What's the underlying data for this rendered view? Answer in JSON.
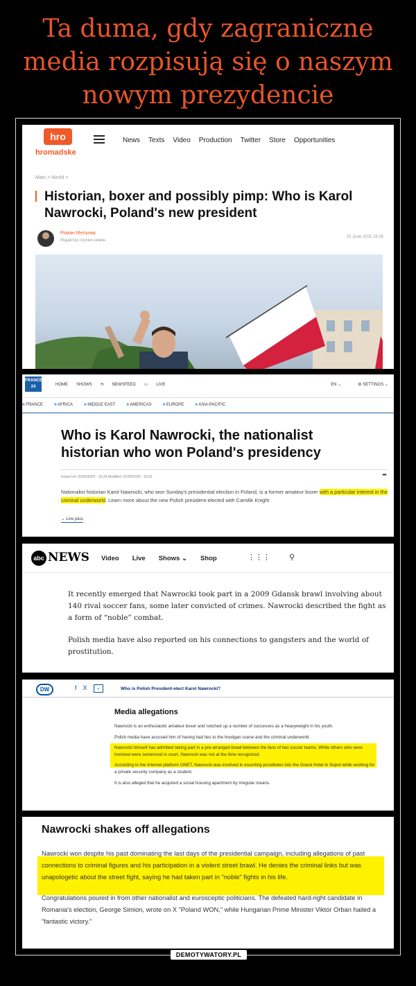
{
  "meme": {
    "title": "Ta duma, gdy zagraniczne media rozpisują się o naszym nowym prezydencie",
    "watermark": "DEMOTYWATORY.PL"
  },
  "hromadske": {
    "logo": "hro",
    "brand": "hromadske",
    "nav": [
      "News",
      "Texts",
      "Video",
      "Production",
      "Twitter",
      "Store",
      "Opportunities"
    ],
    "breadcrumb": "Main > World >",
    "headline": "Historian, boxer and possibly pimp: Who is Karol Nawrocki, Poland's new president",
    "author": "Роман Мельник",
    "author_role": "Редактор стрічки новин",
    "date": "02 June 2025 16:05",
    "photo_colors": {
      "flag_white": "#ffffff",
      "flag_red": "#d4213d",
      "sky": "#dfe8f1"
    }
  },
  "france24": {
    "logo": "FRANCE 24",
    "nav": [
      "HOME",
      "SHOWS",
      "NEWSFEED",
      "LIVE"
    ],
    "lang": "EN",
    "settings": "SETTINGS",
    "regions": [
      "FRANCE",
      "AFRICA",
      "MIDDLE EAST",
      "AMERICAS",
      "EUROPE",
      "ASIA-PACIFIC"
    ],
    "headline": "Who is Karol Nawrocki, the nationalist historian who won Poland's presidency",
    "issued": "Issued on: 02/06/2025 - 16:39   Modified: 02/06/2025 - 16:59",
    "body_plain": "Nationalist historian Karol Nawrocki, who won Sunday's presidential election in Poland, is a former amateur boxer ",
    "body_highlight": "with a particular interest in the criminal underworld",
    "body_end": ". Learn more about the new Polish president-elected with Camille Knight",
    "more": "Lire plus"
  },
  "abc": {
    "logo": "abc",
    "brand": "NEWS",
    "nav": [
      "Video",
      "Live",
      "Shows",
      "Shop"
    ],
    "paragraphs": [
      "It recently emerged that Nawrocki took part in a 2009 Gdansk brawl involving about 140 rival soccer fans, some later convicted of crimes. Nawrocki described the fight as a form of “noble” combat.",
      "Polish media have also reported on his connections to gangsters and the world of prostitution."
    ]
  },
  "dw": {
    "logo": "DW",
    "share": [
      "f",
      "X"
    ],
    "article_title": "Who is Polish President-elect Karol Nawrocki?",
    "heading": "Media allegations",
    "paragraphs": [
      "Nawrocki is an enthusiastic amateur boxer and notched up a number of successes as a heavyweight in his youth.",
      "Polish media have accused him of having had ties to the hooligan scene and the criminal underworld.",
      "Nawrocki himself has admitted taking part in a pre-arranged brawl between the fans of two soccer teams. While others who were involved were sentenced in court, Nawrocki was not at the time recognized.",
      "According to the Internet platform ONET, Nawrocki was involved in escorting prostitutes into the Grand Hotel in Sopot while working for a private security company as a student.",
      "It is also alleged that he acquired a social housing apartment by irregular means."
    ]
  },
  "article5": {
    "heading": "Nawrocki shakes off allegations",
    "paragraphs": [
      "Nawrocki won despite his past dominating the last days of the presidential campaign, including allegations of past connections to criminal figures and his participation in a violent street brawl. He denies the criminal links but was unapologetic about the street fight, saying he had taken part in \"noble\" fights in his life.",
      "Congratulations poured in from other nationalist and eurosceptic politicians. The defeated hard-right candidate in Romania's election, George Simion, wrote on X \"Poland WON,\" while Hungarian Prime Minister Viktor Orban hailed a \"fantastic victory.\""
    ]
  },
  "colors": {
    "title": "#e8552a",
    "hromadske": "#f05a28",
    "france24": "#1b5fa8",
    "highlight": "#fff200",
    "dw": "#0055aa"
  }
}
